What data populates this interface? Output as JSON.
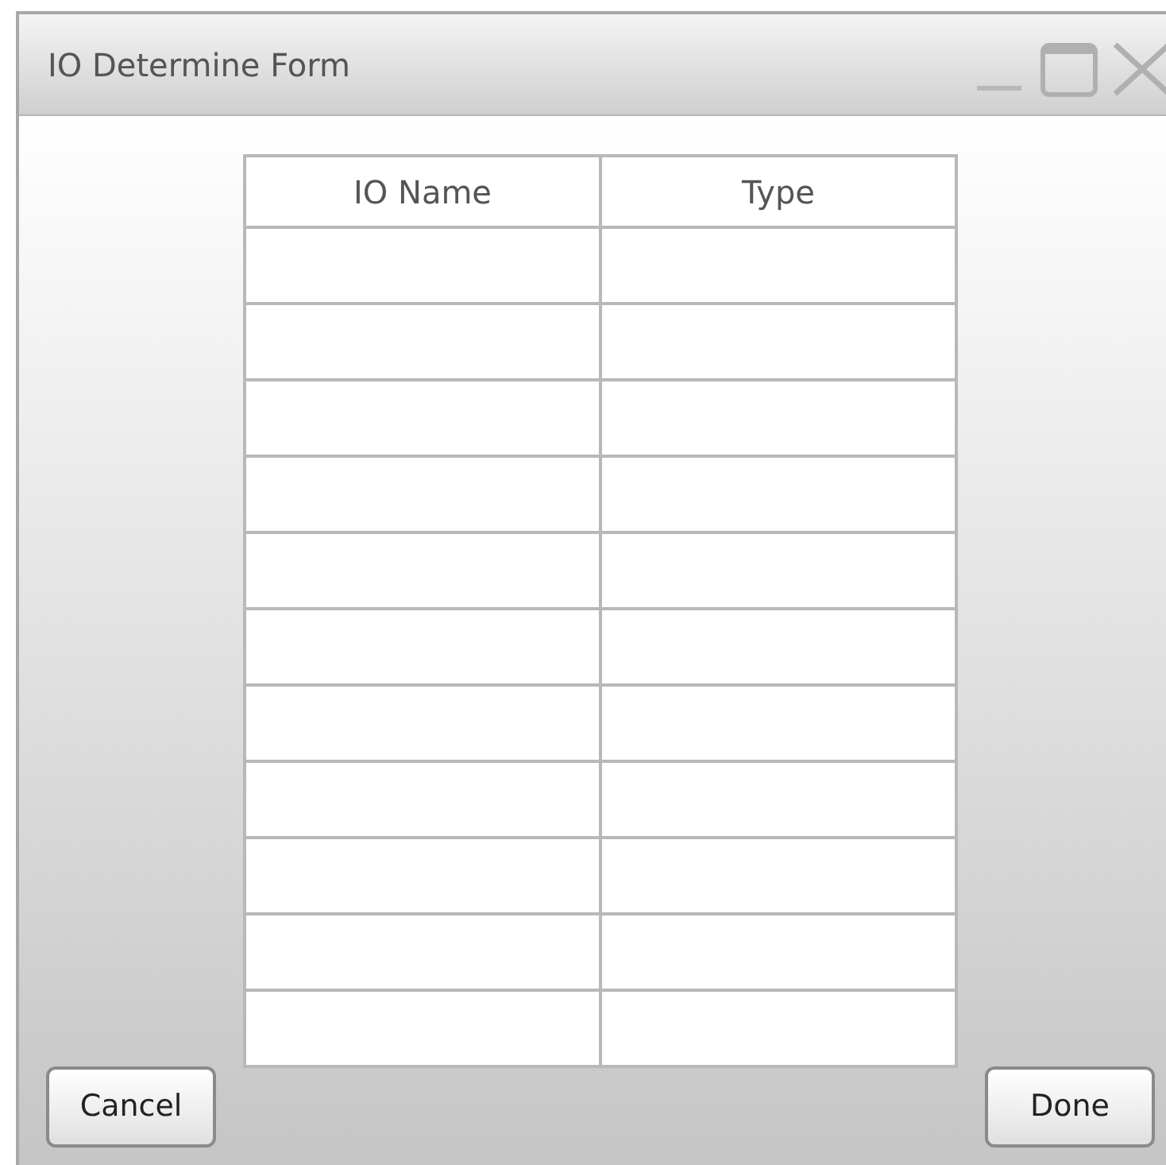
{
  "window": {
    "title": "IO Determine Form"
  },
  "table": {
    "columns": [
      "IO Name",
      "Type"
    ]
  },
  "buttons": [
    {
      "label": "Cancel"
    },
    {
      "label": "Done"
    }
  ]
}
